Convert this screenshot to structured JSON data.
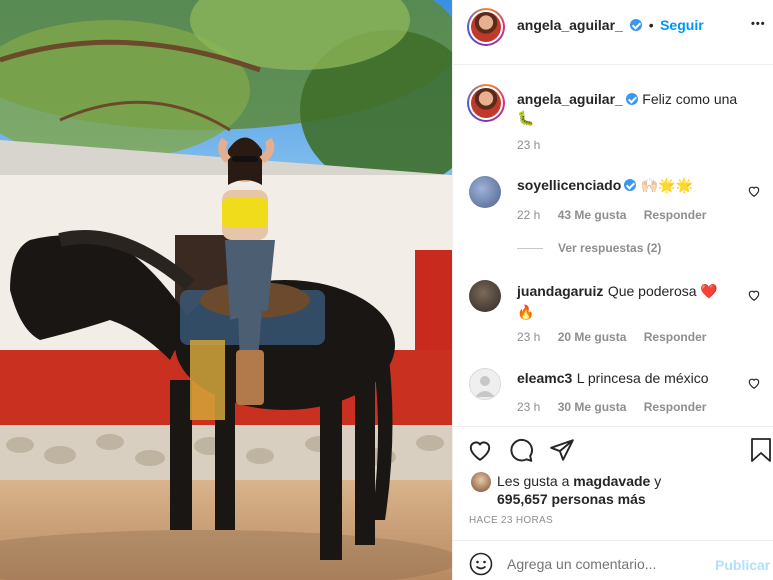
{
  "header": {
    "username": "angela_aguilar_",
    "separator": "•",
    "follow_label": "Seguir",
    "more_label": "•••"
  },
  "caption": {
    "username": "angela_aguilar_",
    "text": "Feliz como una",
    "emoji": "🐛",
    "time": "23 h"
  },
  "comments": [
    {
      "username": "soyellicenciado",
      "verified": true,
      "text": "🙌🏻🌟🌟",
      "time": "22 h",
      "likes": "43 Me gusta",
      "reply": "Responder",
      "view_replies": "Ver respuestas (2)"
    },
    {
      "username": "juandagaruiz",
      "text": "Que poderosa ❤️",
      "text2": "🔥",
      "time": "23 h",
      "likes": "20 Me gusta",
      "reply": "Responder"
    },
    {
      "username": "eleamc3",
      "text": "L princesa de méxico",
      "time": "23 h",
      "likes": "30 Me gusta",
      "reply": "Responder"
    }
  ],
  "likes": {
    "prefix": "Les gusta a",
    "user": "magdavade",
    "conj": "y",
    "count": "695,657 personas más"
  },
  "timestamp": "HACE 23 HORAS",
  "comment_box": {
    "placeholder": "Agrega un comentario...",
    "post_label": "Publicar"
  },
  "colors": {
    "link_blue": "#0095f6",
    "muted": "#8e8e8e",
    "post_disabled": "#b2dffc"
  }
}
